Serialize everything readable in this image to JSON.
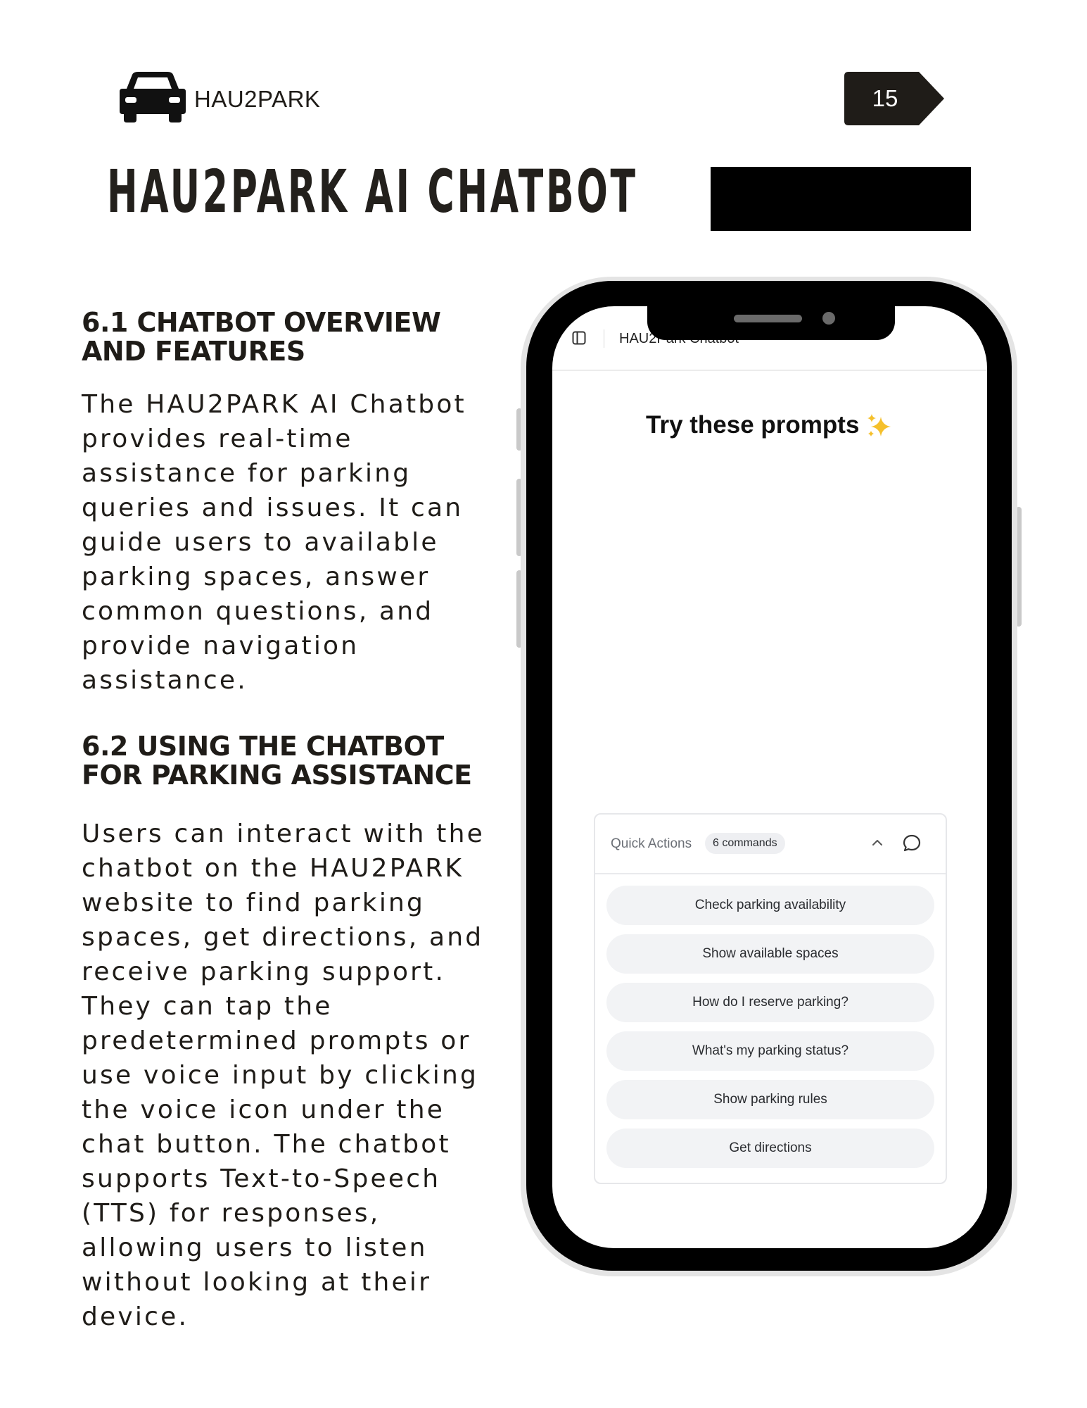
{
  "header": {
    "brand_name": "HAU2PARK",
    "brand_icon": "car-icon",
    "page_number": "15",
    "title": "HAU2PARK AI CHATBOT"
  },
  "sections": [
    {
      "heading": "6.1 CHATBOT OVERVIEW AND FEATURES",
      "lines": [
        "The HAU2PARK AI Chatbot",
        "provides real-time",
        "assistance for parking",
        "queries and issues. It can",
        "guide users to available",
        "parking spaces, answer",
        "common questions, and",
        "provide navigation",
        "assistance."
      ]
    },
    {
      "heading": "6.2 USING THE CHATBOT FOR PARKING ASSISTANCE",
      "lines": [
        "Users can interact with the",
        "chatbot on the HAU2PARK",
        "website to find parking",
        "spaces, get directions, and",
        "receive parking support.",
        "They can tap the",
        "predetermined prompts or",
        "use voice input by clicking",
        "the voice icon under the",
        "chat button. The chatbot",
        "supports Text-to-Speech",
        "(TTS) for responses,",
        "allowing users to listen",
        "without looking at their",
        "device."
      ]
    }
  ],
  "phone": {
    "app_title": "HAU2Park Chatbot",
    "prompts_title": "Try these prompts",
    "sparkle_icon": "sparkles-icon",
    "quick_actions": {
      "label": "Quick Actions",
      "badge": "6 commands",
      "buttons": [
        "Check parking availability",
        "Show available spaces",
        "How do I reserve parking?",
        "What's my parking status?",
        "Show parking rules",
        "Get directions"
      ]
    }
  },
  "colors": {
    "text": "#1f1c18",
    "page_tag": "#1f1c18",
    "sparkle": "#f5c02c",
    "button_bg": "#f2f3f5"
  }
}
